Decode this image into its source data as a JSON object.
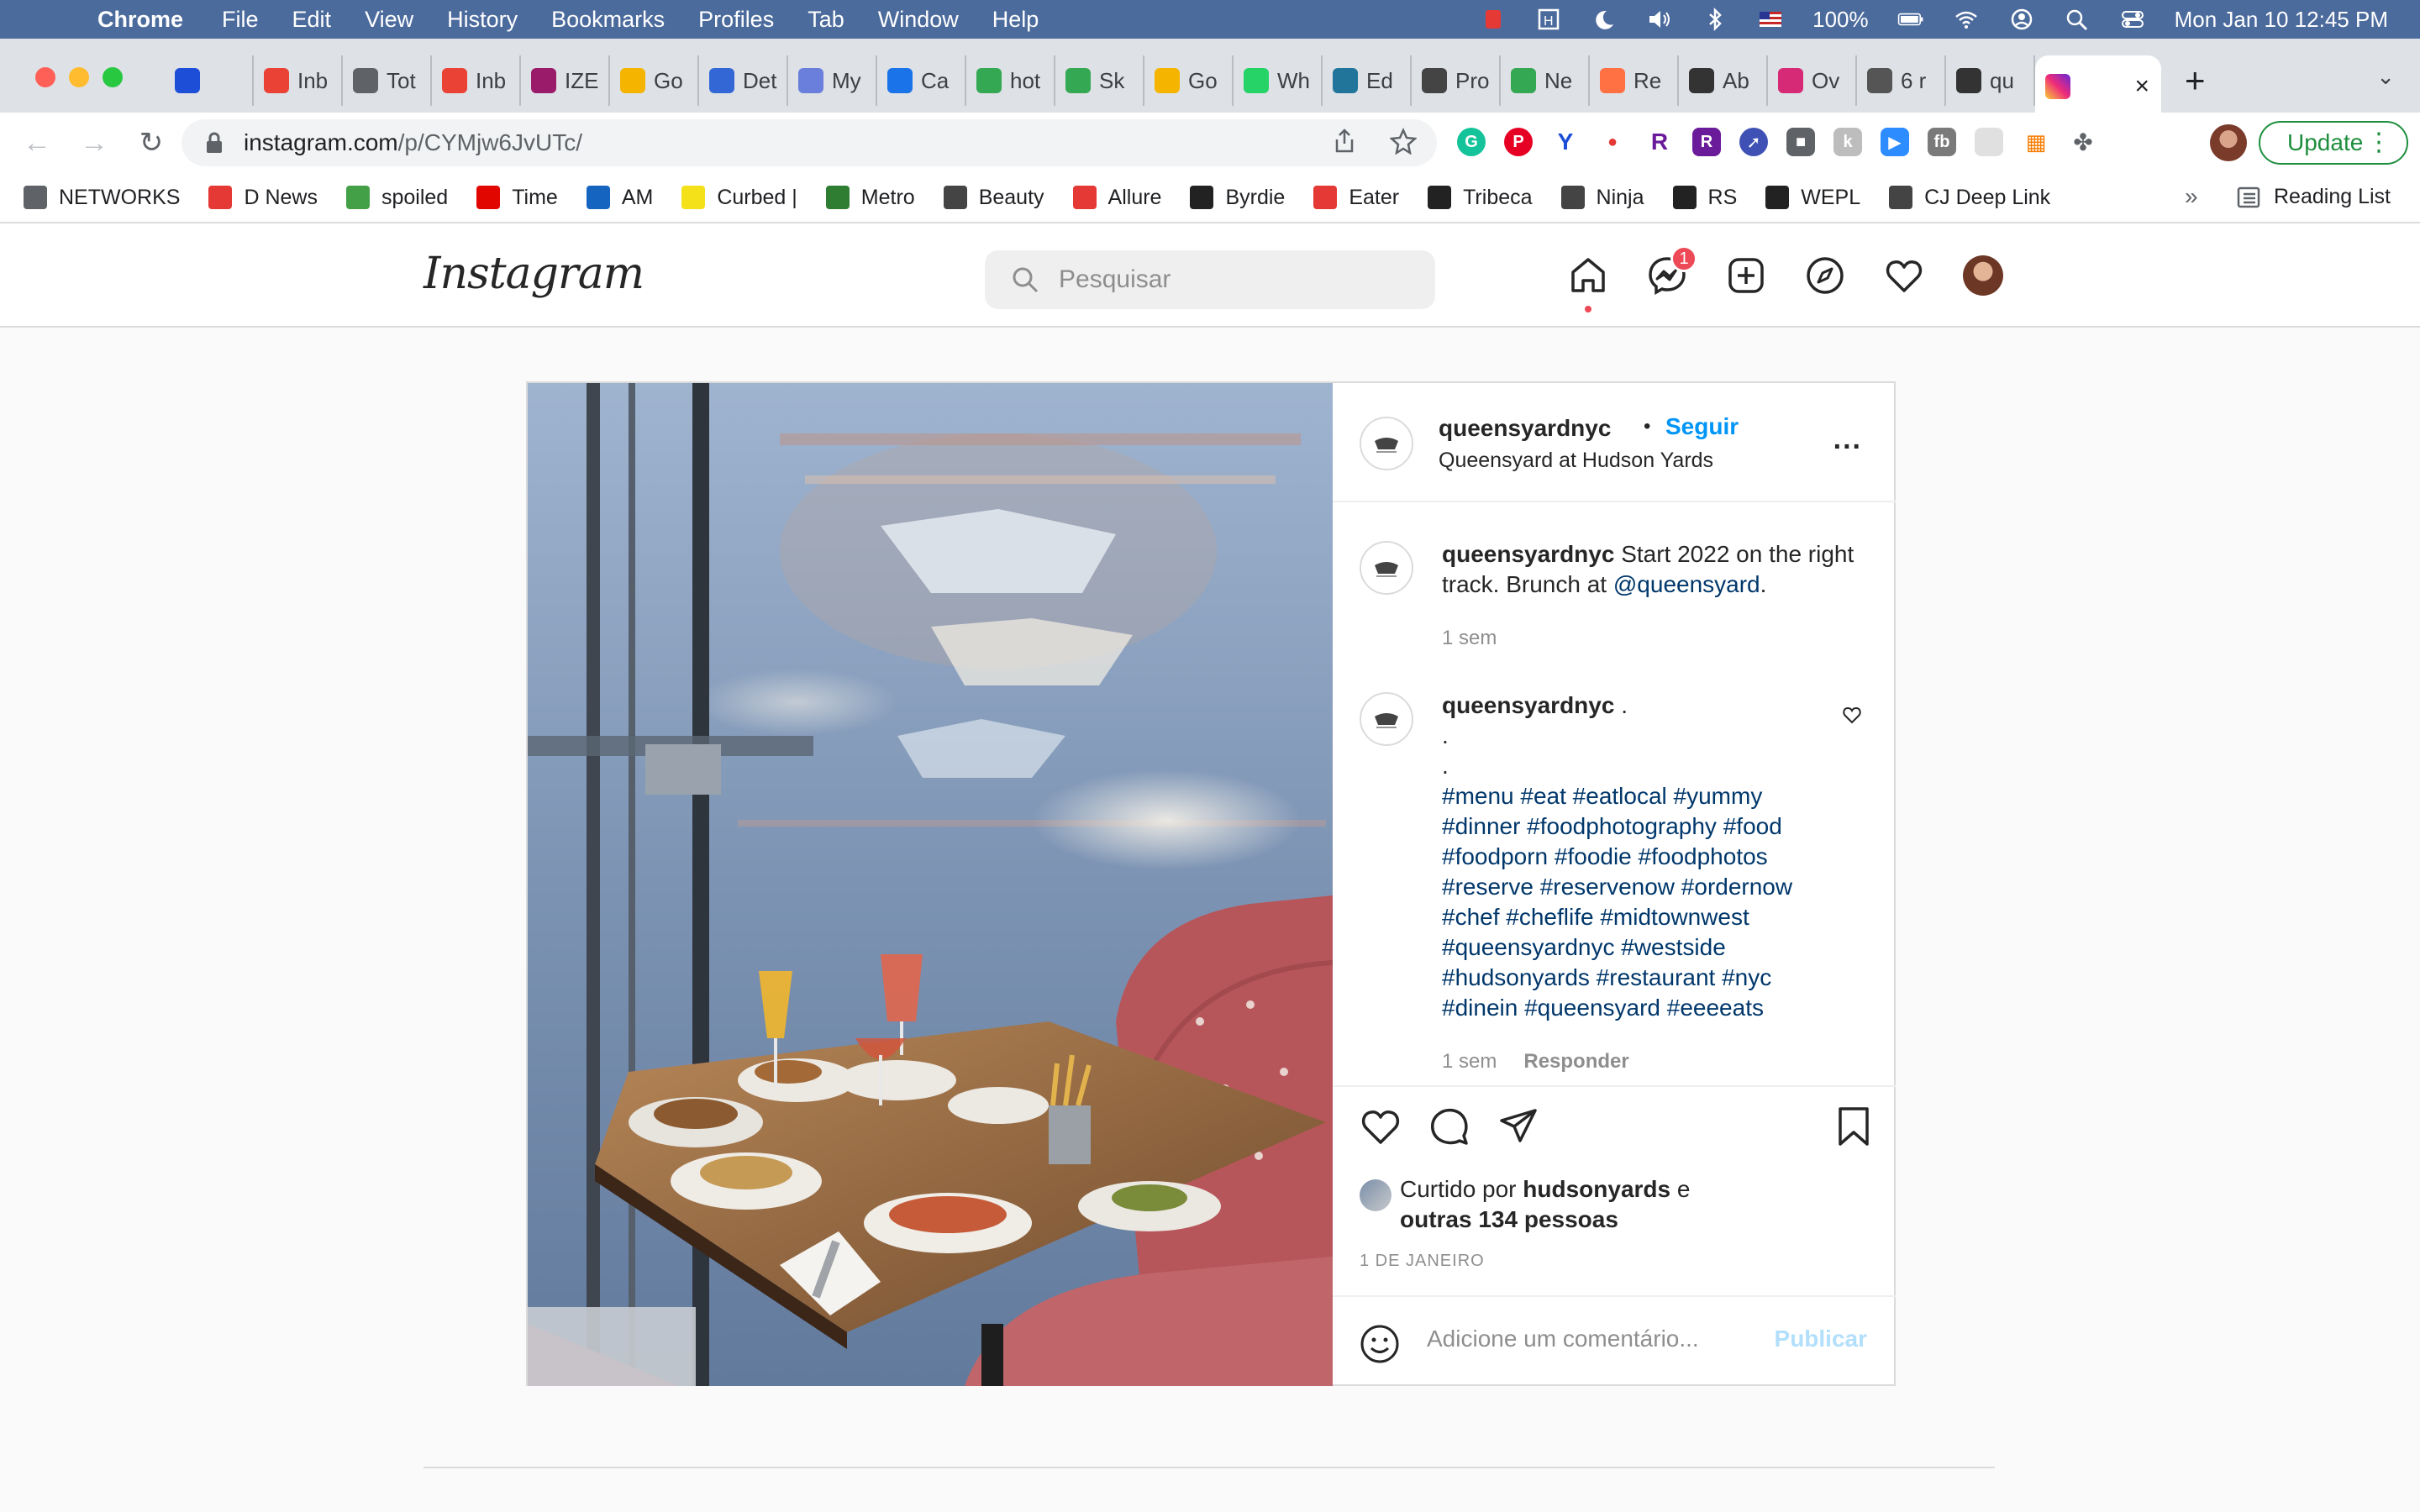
{
  "menubar": {
    "app": "Chrome",
    "items": [
      "File",
      "Edit",
      "View",
      "History",
      "Bookmarks",
      "Profiles",
      "Tab",
      "Window",
      "Help"
    ],
    "battery": "100%",
    "datetime": "Mon Jan 10  12:45 PM"
  },
  "tabs": [
    {
      "label": "",
      "icon": "yext-icon",
      "color": "#1d4ed8"
    },
    {
      "label": "Inb",
      "icon": "gmail-icon",
      "color": "#ea4335"
    },
    {
      "label": "Tot",
      "icon": "globe-icon",
      "color": "#5f6368"
    },
    {
      "label": "Inb",
      "icon": "gmail-icon",
      "color": "#ea4335"
    },
    {
      "label": "IZE",
      "icon": "ize-icon",
      "color": "#9b1b6b"
    },
    {
      "label": "Go",
      "icon": "google-slides-icon",
      "color": "#f4b400"
    },
    {
      "label": "Det",
      "icon": "doc-icon",
      "color": "#3367d6"
    },
    {
      "label": "My",
      "icon": "compass-icon",
      "color": "#6a7fdb"
    },
    {
      "label": "Ca",
      "icon": "calendar-icon",
      "color": "#1a73e8"
    },
    {
      "label": "hot",
      "icon": "maps-icon",
      "color": "#34a853"
    },
    {
      "label": "Sk",
      "icon": "maps-icon",
      "color": "#34a853"
    },
    {
      "label": "Go",
      "icon": "google-slides-icon",
      "color": "#f4b400"
    },
    {
      "label": "Wh",
      "icon": "whatsapp-icon",
      "color": "#25d366"
    },
    {
      "label": "Ed",
      "icon": "wordpress-icon",
      "color": "#21759b"
    },
    {
      "label": "Pro",
      "icon": "x-icon",
      "color": "#444"
    },
    {
      "label": "Ne",
      "icon": "maps-icon",
      "color": "#34a853"
    },
    {
      "label": "Re",
      "icon": "circle-icon",
      "color": "#ff7043"
    },
    {
      "label": "Ab",
      "icon": "chart-icon",
      "color": "#333"
    },
    {
      "label": "Ov",
      "icon": "instagram-icon",
      "color": "#d62976"
    },
    {
      "label": "6 r",
      "icon": "curve-icon",
      "color": "#555"
    },
    {
      "label": "qu",
      "icon": "queensyard-icon",
      "color": "#333"
    }
  ],
  "active_tab": {
    "icon": "instagram-icon",
    "close": "×"
  },
  "toolbar": {
    "url_host": "instagram.com",
    "url_path": "/p/CYMjw6JvUTc/",
    "update_label": "Update"
  },
  "bookmarks": [
    {
      "label": "NETWORKS",
      "icon": "folder-icon",
      "color": "#5f6368"
    },
    {
      "label": "D News",
      "icon": "dnews-icon",
      "color": "#e53935"
    },
    {
      "label": "spoiled",
      "icon": "spoiled-icon",
      "color": "#43a047"
    },
    {
      "label": "Time",
      "icon": "time-icon",
      "color": "#e10600"
    },
    {
      "label": "AM",
      "icon": "am-icon",
      "color": "#1565c0"
    },
    {
      "label": "Curbed |",
      "icon": "curbed-icon",
      "color": "#f5e11a"
    },
    {
      "label": "Metro",
      "icon": "globe-icon",
      "color": "#2e7d32"
    },
    {
      "label": "Beauty",
      "icon": "beauty-icon",
      "color": "#444"
    },
    {
      "label": "Allure",
      "icon": "allure-icon",
      "color": "#e53935"
    },
    {
      "label": "Byrdie",
      "icon": "byrdie-icon",
      "color": "#222"
    },
    {
      "label": "Eater",
      "icon": "eater-icon",
      "color": "#e53935"
    },
    {
      "label": "Tribeca",
      "icon": "tribeca-icon",
      "color": "#222"
    },
    {
      "label": "Ninja",
      "icon": "globe-icon",
      "color": "#444"
    },
    {
      "label": "RS",
      "icon": "rs-icon",
      "color": "#222"
    },
    {
      "label": "WEPL",
      "icon": "wepl-icon",
      "color": "#222"
    },
    {
      "label": "CJ Deep Link",
      "icon": "globe-icon",
      "color": "#444"
    }
  ],
  "bookmarks_more": "»",
  "reading_list": "Reading List",
  "instagram": {
    "logo": "Instagram",
    "search_placeholder": "Pesquisar",
    "messages_badge": "1"
  },
  "post": {
    "username": "queensyardnyc",
    "dot": "•",
    "follow_label": "Seguir",
    "location": "Queensyard at Hudson Yards",
    "more": "...",
    "caption": {
      "username": "queensyardnyc",
      "text": "Start 2022 on the right track. Brunch at",
      "mention": "@queensyard",
      "end": ".",
      "time": "1 sem"
    },
    "comment": {
      "username": "queensyardnyc",
      "first": ".",
      "lines": [
        ".",
        "."
      ],
      "hashtags": [
        "#menu #eat #eatlocal #yummy",
        "#dinner #foodphotography #food",
        "#foodporn #foodie #foodphotos",
        "#reserve #reservenow #ordernow",
        "#chef #cheflife #midtownwest",
        "#queensyardnyc #westside",
        "#hudsonyards #restaurant #nyc",
        "#dinein #queensyard #eeeeats"
      ],
      "time": "1 sem",
      "reply": "Responder"
    },
    "liked_by_prefix": "Curtido por",
    "liked_by_user": "hudsonyards",
    "liked_by_and": "e",
    "liked_by_others": "outras 134 pessoas",
    "date": "1 DE JANEIRO",
    "comment_placeholder": "Adicione um comentário...",
    "publish": "Publicar"
  }
}
